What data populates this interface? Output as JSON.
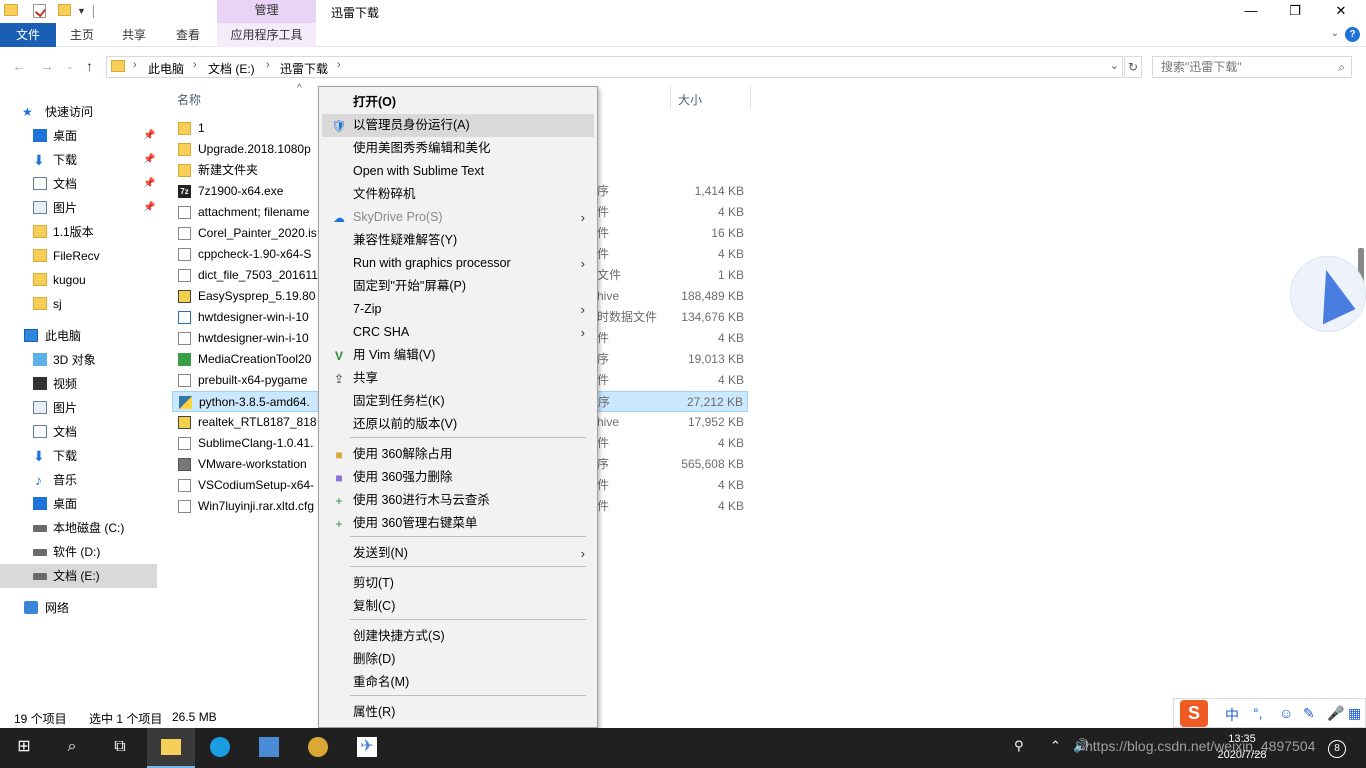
{
  "titlebar": {
    "manage_tab": "管理",
    "title": "迅雷下载",
    "minimize": "—",
    "maximize": "❐",
    "close": "✕"
  },
  "ribbon": {
    "tabs": [
      "文件",
      "主页",
      "共享",
      "查看",
      "应用程序工具"
    ],
    "help": "?"
  },
  "address": {
    "crumbs": [
      "此电脑",
      "文档 (E:)",
      "迅雷下载"
    ],
    "search_placeholder": "搜索\"迅雷下载\""
  },
  "nav": {
    "quick_access": "快速访问",
    "quick_items": [
      "桌面",
      "下载",
      "文档",
      "图片",
      "1.1版本",
      "FileRecv",
      "kugou",
      "sj"
    ],
    "this_pc": "此电脑",
    "pc_items": [
      "3D 对象",
      "视频",
      "图片",
      "文档",
      "下载",
      "音乐",
      "桌面",
      "本地磁盘 (C:)",
      "软件 (D:)",
      "文档 (E:)"
    ],
    "network": "网络"
  },
  "filelist": {
    "col_name": "名称",
    "col_size": "大小",
    "rows": [
      {
        "name": "1",
        "type": "",
        "size": ""
      },
      {
        "name": "Upgrade.2018.1080p",
        "type": "",
        "size": ""
      },
      {
        "name": "新建文件夹",
        "type": "",
        "size": ""
      },
      {
        "name": "7z1900-x64.exe",
        "type": "序",
        "size": "1,414 KB"
      },
      {
        "name": "attachment; filename",
        "type": "件",
        "size": "4 KB"
      },
      {
        "name": "Corel_Painter_2020.is",
        "type": "件",
        "size": "16 KB"
      },
      {
        "name": "cppcheck-1.90-x64-S",
        "type": "件",
        "size": "4 KB"
      },
      {
        "name": "dict_file_7503_201611",
        "type": "文件",
        "size": "1 KB"
      },
      {
        "name": "EasySysprep_5.19.80",
        "type": "hive",
        "size": "188,489 KB"
      },
      {
        "name": "hwtdesigner-win-i-10",
        "type": "时数据文件",
        "size": "134,676 KB"
      },
      {
        "name": "hwtdesigner-win-i-10",
        "type": "件",
        "size": "4 KB"
      },
      {
        "name": "MediaCreationTool20",
        "type": "序",
        "size": "19,013 KB"
      },
      {
        "name": "prebuilt-x64-pygame",
        "type": "件",
        "size": "4 KB"
      },
      {
        "name": "python-3.8.5-amd64.",
        "type": "序",
        "size": "27,212 KB"
      },
      {
        "name": "realtek_RTL8187_818",
        "type": "hive",
        "size": "17,952 KB"
      },
      {
        "name": "SublimeClang-1.0.41.",
        "type": "件",
        "size": "4 KB"
      },
      {
        "name": "VMware-workstation",
        "type": "序",
        "size": "565,608 KB"
      },
      {
        "name": "VSCodiumSetup-x64-",
        "type": "件",
        "size": "4 KB"
      },
      {
        "name": "Win7luyinji.rar.xltd.cfg",
        "type": "件",
        "size": "4 KB"
      }
    ]
  },
  "status": {
    "count": "19 个项目",
    "selection": "选中 1 个项目",
    "size": "26.5 MB"
  },
  "context_menu": {
    "items": [
      {
        "label": "打开(O)",
        "bold": true
      },
      {
        "label": "以管理员身份运行(A)",
        "icon": "shield-icon"
      },
      {
        "label": "使用美图秀秀编辑和美化"
      },
      {
        "label": "Open with Sublime Text"
      },
      {
        "label": "文件粉碎机"
      },
      {
        "label": "SkyDrive Pro(S)",
        "icon": "cloud-icon",
        "submenu": true,
        "disabled": true
      },
      {
        "label": "兼容性疑难解答(Y)"
      },
      {
        "label": "Run with graphics processor",
        "submenu": true
      },
      {
        "label": "固定到\"开始\"屏幕(P)"
      },
      {
        "label": "7-Zip",
        "submenu": true
      },
      {
        "label": "CRC SHA",
        "submenu": true
      },
      {
        "label": "用 Vim 编辑(V)",
        "icon": "vim-icon"
      },
      {
        "label": "共享",
        "icon": "share-icon"
      },
      {
        "label": "固定到任务栏(K)"
      },
      {
        "label": "还原以前的版本(V)"
      },
      {
        "label": "使用 360解除占用",
        "icon": "360-unlock-icon"
      },
      {
        "label": "使用 360强力删除",
        "icon": "360-delete-icon"
      },
      {
        "label": "使用 360进行木马云查杀",
        "icon": "360-scan-icon"
      },
      {
        "label": "使用 360管理右键菜单",
        "icon": "360-menu-icon"
      },
      {
        "label": "发送到(N)",
        "submenu": true
      },
      {
        "label": "剪切(T)"
      },
      {
        "label": "复制(C)"
      },
      {
        "label": "创建快捷方式(S)"
      },
      {
        "label": "删除(D)"
      },
      {
        "label": "重命名(M)"
      },
      {
        "label": "属性(R)"
      }
    ]
  },
  "ime": {
    "logo": "S",
    "mode": "中"
  },
  "taskbar": {
    "time": "13:35",
    "date": "2020/7/28",
    "notification_count": "8",
    "watermark": "https://blog.csdn.net/weixin_4897504"
  },
  "colors": {
    "accent": "#1a5fb4",
    "manage_tab": "#e9d3f7",
    "selection": "#cce8ff",
    "taskbar": "#202020"
  }
}
